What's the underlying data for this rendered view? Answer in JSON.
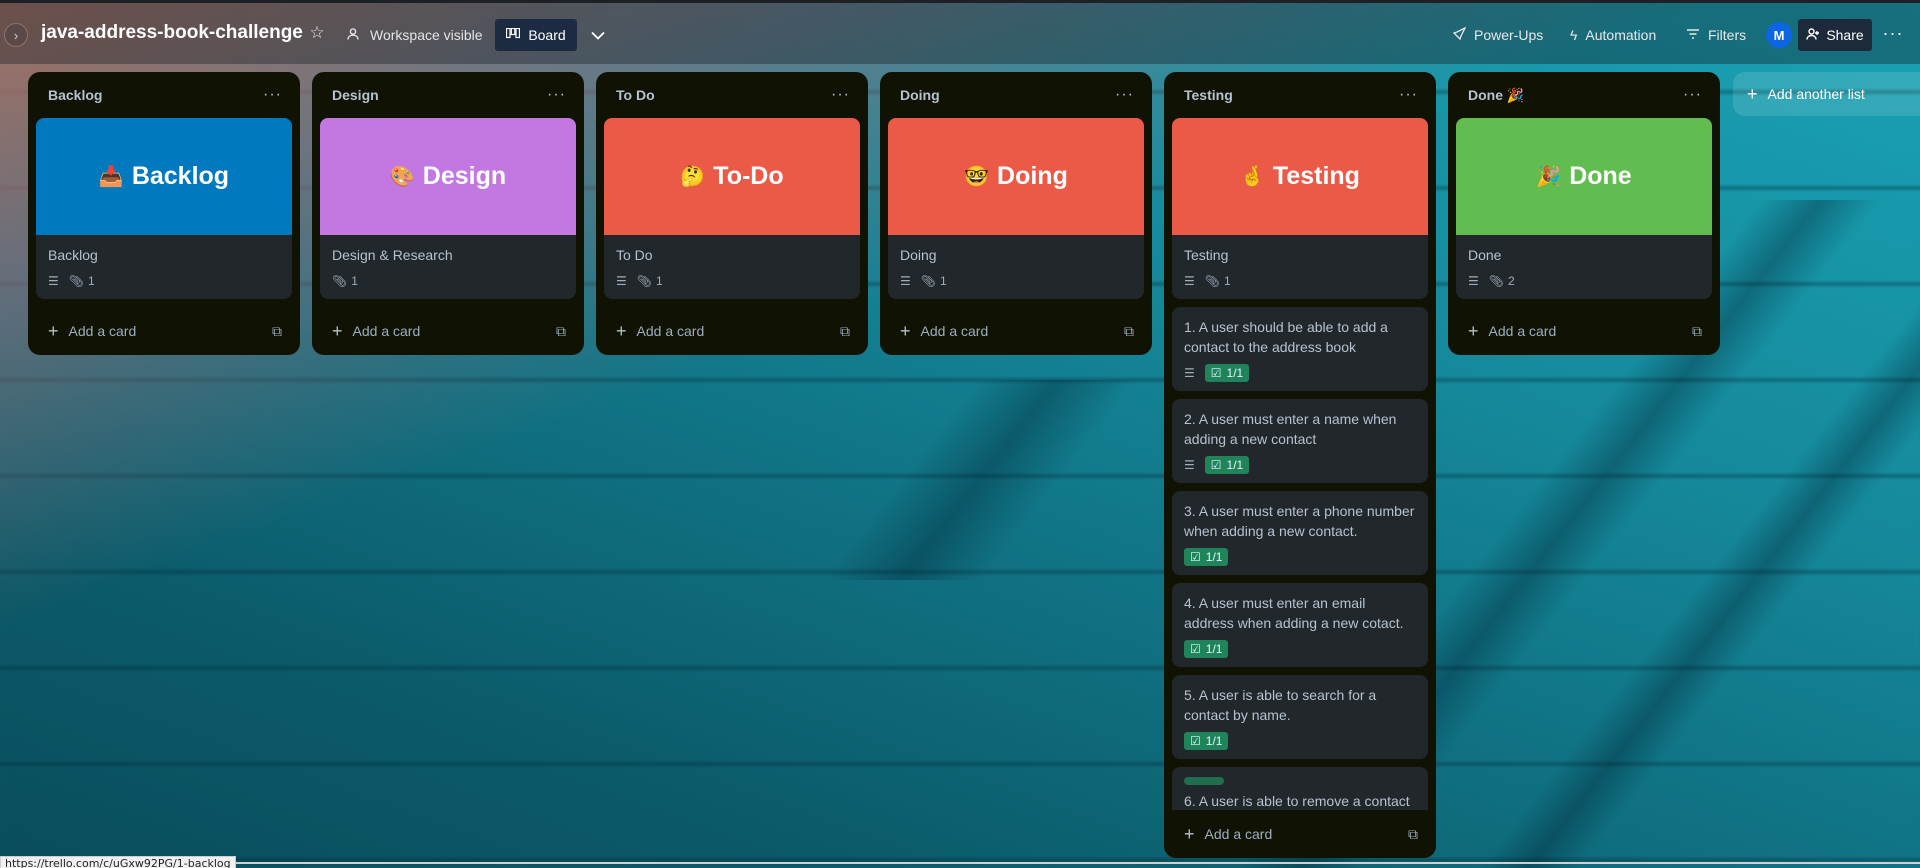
{
  "colors": {
    "cover_backlog": "#0079bf",
    "cover_design": "#c377e0",
    "cover_todo": "#eb5a46",
    "cover_doing": "#eb5a46",
    "cover_testing": "#eb5a46",
    "cover_done": "#61bd4f",
    "list_bg": "#101204",
    "card_bg": "#22272b",
    "check_badge": "#1f845a"
  },
  "header": {
    "sidebar_toggle_icon": "chevron-right-icon",
    "board_title": "java-address-book-challenge",
    "visibility": "Workspace visible",
    "view_button": "Board",
    "power_ups": "Power-Ups",
    "automation": "Automation",
    "filters": "Filters",
    "avatar_initial": "M",
    "share": "Share"
  },
  "lists": [
    {
      "title": "Backlog",
      "add_card": "Add a card",
      "cover": {
        "emoji": "📥",
        "text": "Backlog"
      },
      "cards": [
        {
          "title": "Backlog",
          "has_description": true,
          "attachments": "1"
        }
      ]
    },
    {
      "title": "Design",
      "add_card": "Add a card",
      "cover": {
        "emoji": "🎨",
        "text": "Design"
      },
      "cards": [
        {
          "title": "Design & Research",
          "has_description": false,
          "attachments": "1"
        }
      ]
    },
    {
      "title": "To Do",
      "add_card": "Add a card",
      "cover": {
        "emoji": "🤔",
        "text": "To-Do"
      },
      "cards": [
        {
          "title": "To Do",
          "has_description": true,
          "attachments": "1"
        }
      ]
    },
    {
      "title": "Doing",
      "add_card": "Add a card",
      "cover": {
        "emoji": "🤓",
        "text": "Doing"
      },
      "cards": [
        {
          "title": "Doing",
          "has_description": true,
          "attachments": "1"
        }
      ]
    },
    {
      "title": "Testing",
      "add_card": "Add a card",
      "cover": {
        "emoji": "🤞",
        "text": "Testing"
      },
      "cards": [
        {
          "title": "Testing",
          "has_description": true,
          "attachments": "1"
        },
        {
          "title": "1. A user should be able to add a contact to the address book",
          "has_description": true,
          "checklist": "1/1"
        },
        {
          "title": "2. A user must enter a name when adding a new contact",
          "has_description": true,
          "checklist": "1/1"
        },
        {
          "title": "3. A user must enter a phone number when adding a new contact.",
          "has_description": false,
          "checklist": "1/1"
        },
        {
          "title": "4. A user must enter an email address when adding a new cotact.",
          "has_description": false,
          "checklist": "1/1"
        },
        {
          "title": "5. A user is able to search for a contact by name.",
          "has_description": false,
          "checklist": "1/1"
        },
        {
          "title": "6. A user is able to remove a contact",
          "has_label": true
        }
      ]
    },
    {
      "title": "Done 🎉",
      "add_card": "Add a card",
      "cover": {
        "emoji": "🎉",
        "text": "Done"
      },
      "cards": [
        {
          "title": "Done",
          "has_description": true,
          "attachments": "2"
        }
      ]
    }
  ],
  "add_list": "Add another list",
  "status_bar_url": "https://trello.com/c/uGxw92PG/1-backlog"
}
